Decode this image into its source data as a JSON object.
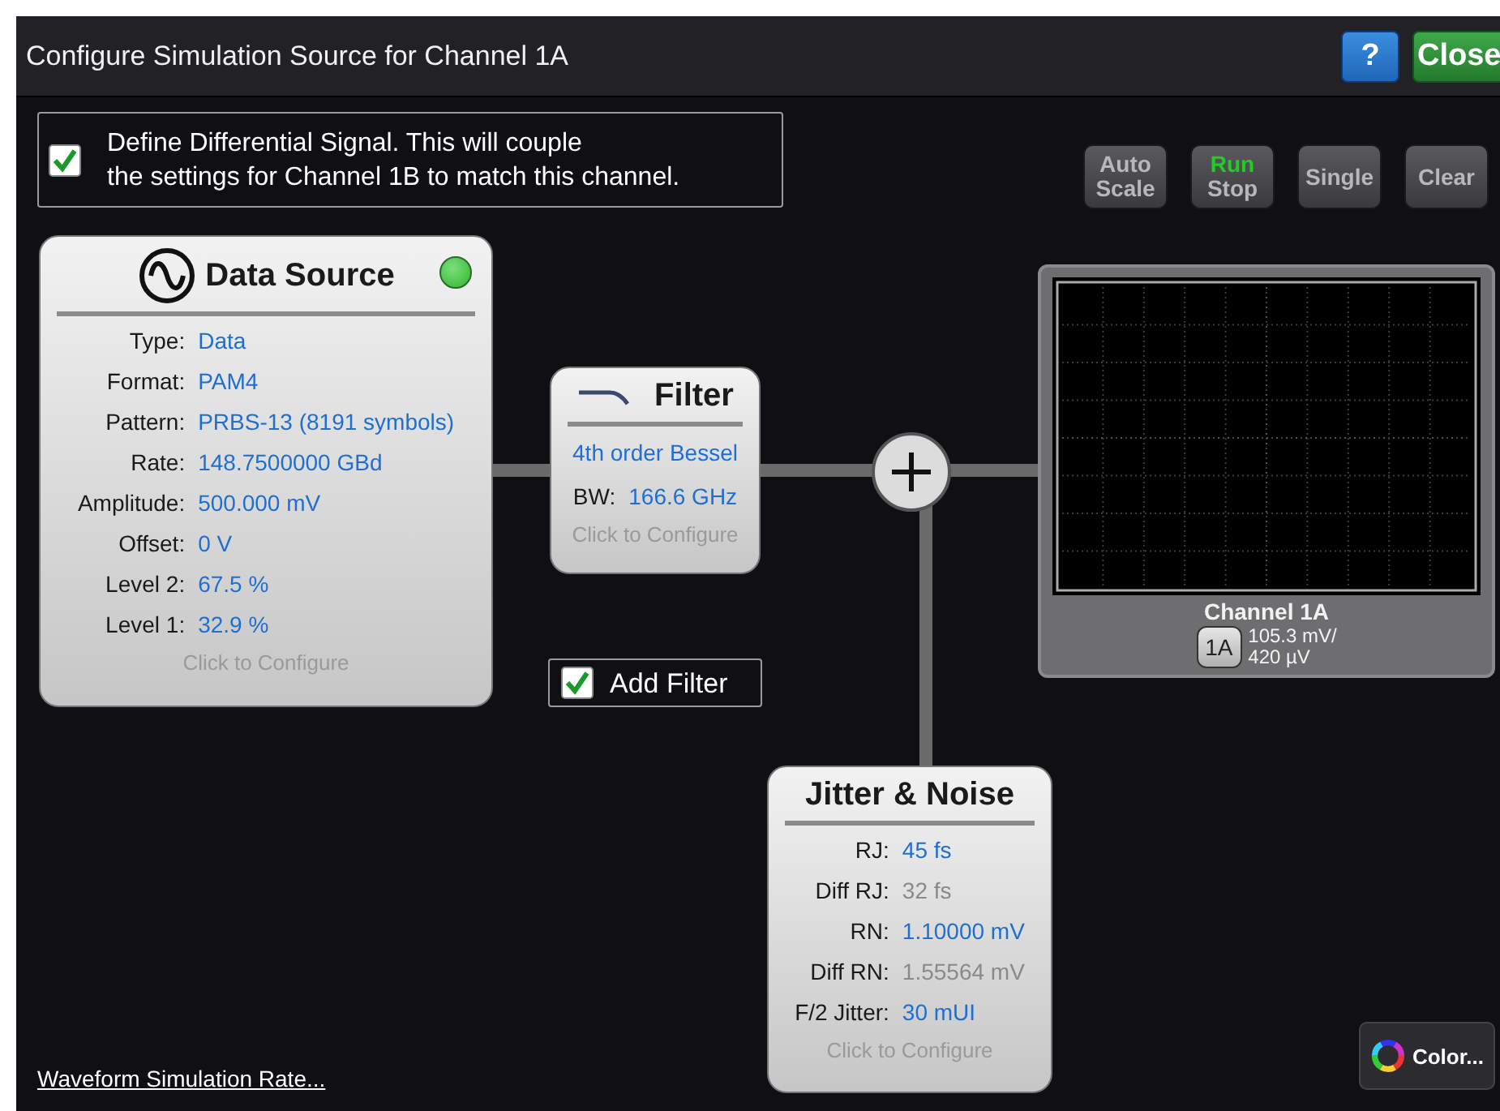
{
  "window": {
    "title": "Configure Simulation Source for Channel 1A",
    "help_button": "?",
    "close_button": "Close"
  },
  "differential": {
    "checked": true,
    "lines": [
      "Define Differential Signal.  This will couple",
      "the settings for Channel 1B to match this channel."
    ]
  },
  "toolbar": [
    {
      "kind": "plain",
      "lines": [
        "Auto",
        "Scale"
      ]
    },
    {
      "kind": "run-stop",
      "lines": [
        "Run",
        "Stop"
      ],
      "running": true
    },
    {
      "kind": "plain",
      "lines": [
        "Single"
      ]
    },
    {
      "kind": "plain",
      "lines": [
        "Clear"
      ]
    }
  ],
  "data_source": {
    "title": "Data Source",
    "on": true,
    "rows": [
      {
        "label": "Type:",
        "value": "Data"
      },
      {
        "label": "Format:",
        "value": "PAM4"
      },
      {
        "label": "Pattern:",
        "value": "PRBS-13 (8191 symbols)"
      },
      {
        "label": "Rate:",
        "value": "148.7500000 GBd"
      },
      {
        "label": "Amplitude:",
        "value": "500.000 mV"
      },
      {
        "label": "Offset:",
        "value": "0 V"
      },
      {
        "label": "Level 2:",
        "value": "67.5 %"
      },
      {
        "label": "Level 1:",
        "value": "32.9 %"
      }
    ],
    "footer": "Click to Configure"
  },
  "filter": {
    "title": "Filter",
    "type": "4th order Bessel",
    "rows": [
      {
        "label": "BW:",
        "value": "166.6 GHz"
      }
    ],
    "footer": "Click to Configure"
  },
  "add_filter": {
    "label": "Add Filter",
    "checked": true
  },
  "scope": {
    "channel": "Channel 1A",
    "badge": "1A",
    "scale": [
      "105.3 mV/",
      "420 µV"
    ]
  },
  "jitter_noise": {
    "title": "Jitter & Noise",
    "rows": [
      {
        "label": "RJ:",
        "value": "45 fs",
        "disabled": false
      },
      {
        "label": "Diff RJ:",
        "value": "32 fs",
        "disabled": true
      },
      {
        "label": "RN:",
        "value": "1.10000 mV",
        "disabled": false
      },
      {
        "label": "Diff RN:",
        "value": "1.55564 mV",
        "disabled": true
      },
      {
        "label": "F/2 Jitter:",
        "value": "30 mUI",
        "disabled": false
      }
    ],
    "footer": "Click to Configure"
  },
  "footer": {
    "link": "Waveform Simulation Rate...",
    "color_button": "Color..."
  }
}
